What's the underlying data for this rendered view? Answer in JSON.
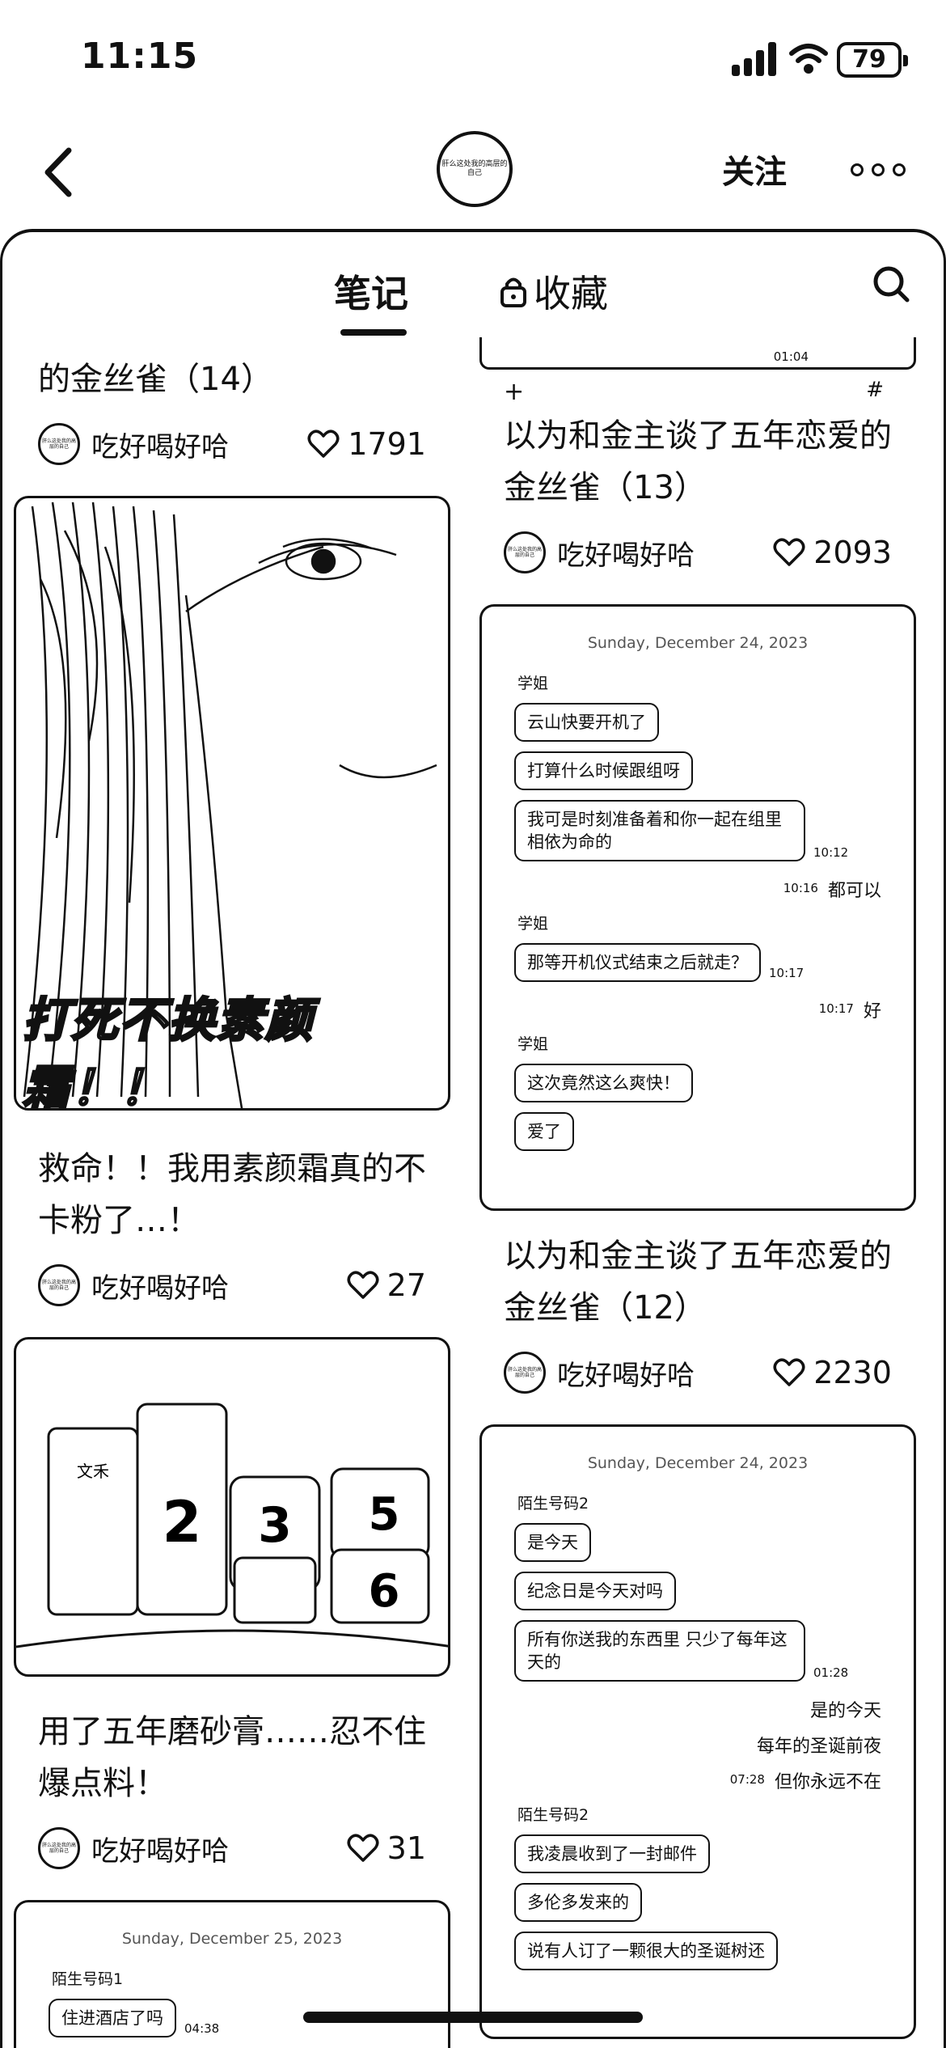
{
  "status": {
    "time": "11:15",
    "battery": "79"
  },
  "header": {
    "follow_label": "关注",
    "avatar_text": "肝么这处我的高层的自己"
  },
  "tabs": {
    "notes": "笔记",
    "favorites": "收藏"
  },
  "author": "吃好喝好哈",
  "left": {
    "card1": {
      "title": "的金丝雀（14）",
      "likes": "1791"
    },
    "card2": {
      "overlay": "打死不换素颜霜！！",
      "title": "救命！！我用素颜霜真的不卡粉了…！",
      "likes": "27"
    },
    "card3": {
      "title": "用了五年磨砂膏……忍不住爆点料！",
      "likes": "31",
      "product_label": "文禾"
    },
    "card4": {
      "date": "Sunday, December 25, 2023",
      "name": "陌生号码1",
      "msg": "住进酒店了吗",
      "time": "04:38"
    }
  },
  "right": {
    "snip": {
      "time": "01:04"
    },
    "card1": {
      "title": "以为和金主谈了五年恋爱的金丝雀（13）",
      "likes": "2093"
    },
    "chat1": {
      "date": "Sunday, December 24, 2023",
      "name1": "学姐",
      "m1": "云山快要开机了",
      "m2": "打算什么时候跟组呀",
      "m3": "我可是时刻准备着和你一起在组里相依为命的",
      "t1": "10:12",
      "r1": "都可以",
      "t2": "10:16",
      "name2": "学姐",
      "m4": "那等开机仪式结束之后就走？",
      "t3": "10:17",
      "r2": "好",
      "t4": "10:17",
      "name3": "学姐",
      "m5": "这次竟然这么爽快！",
      "m6": "爱了"
    },
    "card2": {
      "title": "以为和金主谈了五年恋爱的金丝雀（12）",
      "likes": "2230"
    },
    "chat2": {
      "date": "Sunday, December 24, 2023",
      "name1": "陌生号码2",
      "m1": "是今天",
      "m2": "纪念日是今天对吗",
      "m3": "所有你送我的东西里 只少了每年这天的",
      "t1": "01:28",
      "r1": "是的今天",
      "r2": "每年的圣诞前夜",
      "r3": "但你永远不在",
      "t2": "07:28",
      "name2": "陌生号码2",
      "m4": "我凌晨收到了一封邮件",
      "m5": "多伦多发来的",
      "m6": "说有人订了一颗很大的圣诞树还"
    }
  }
}
